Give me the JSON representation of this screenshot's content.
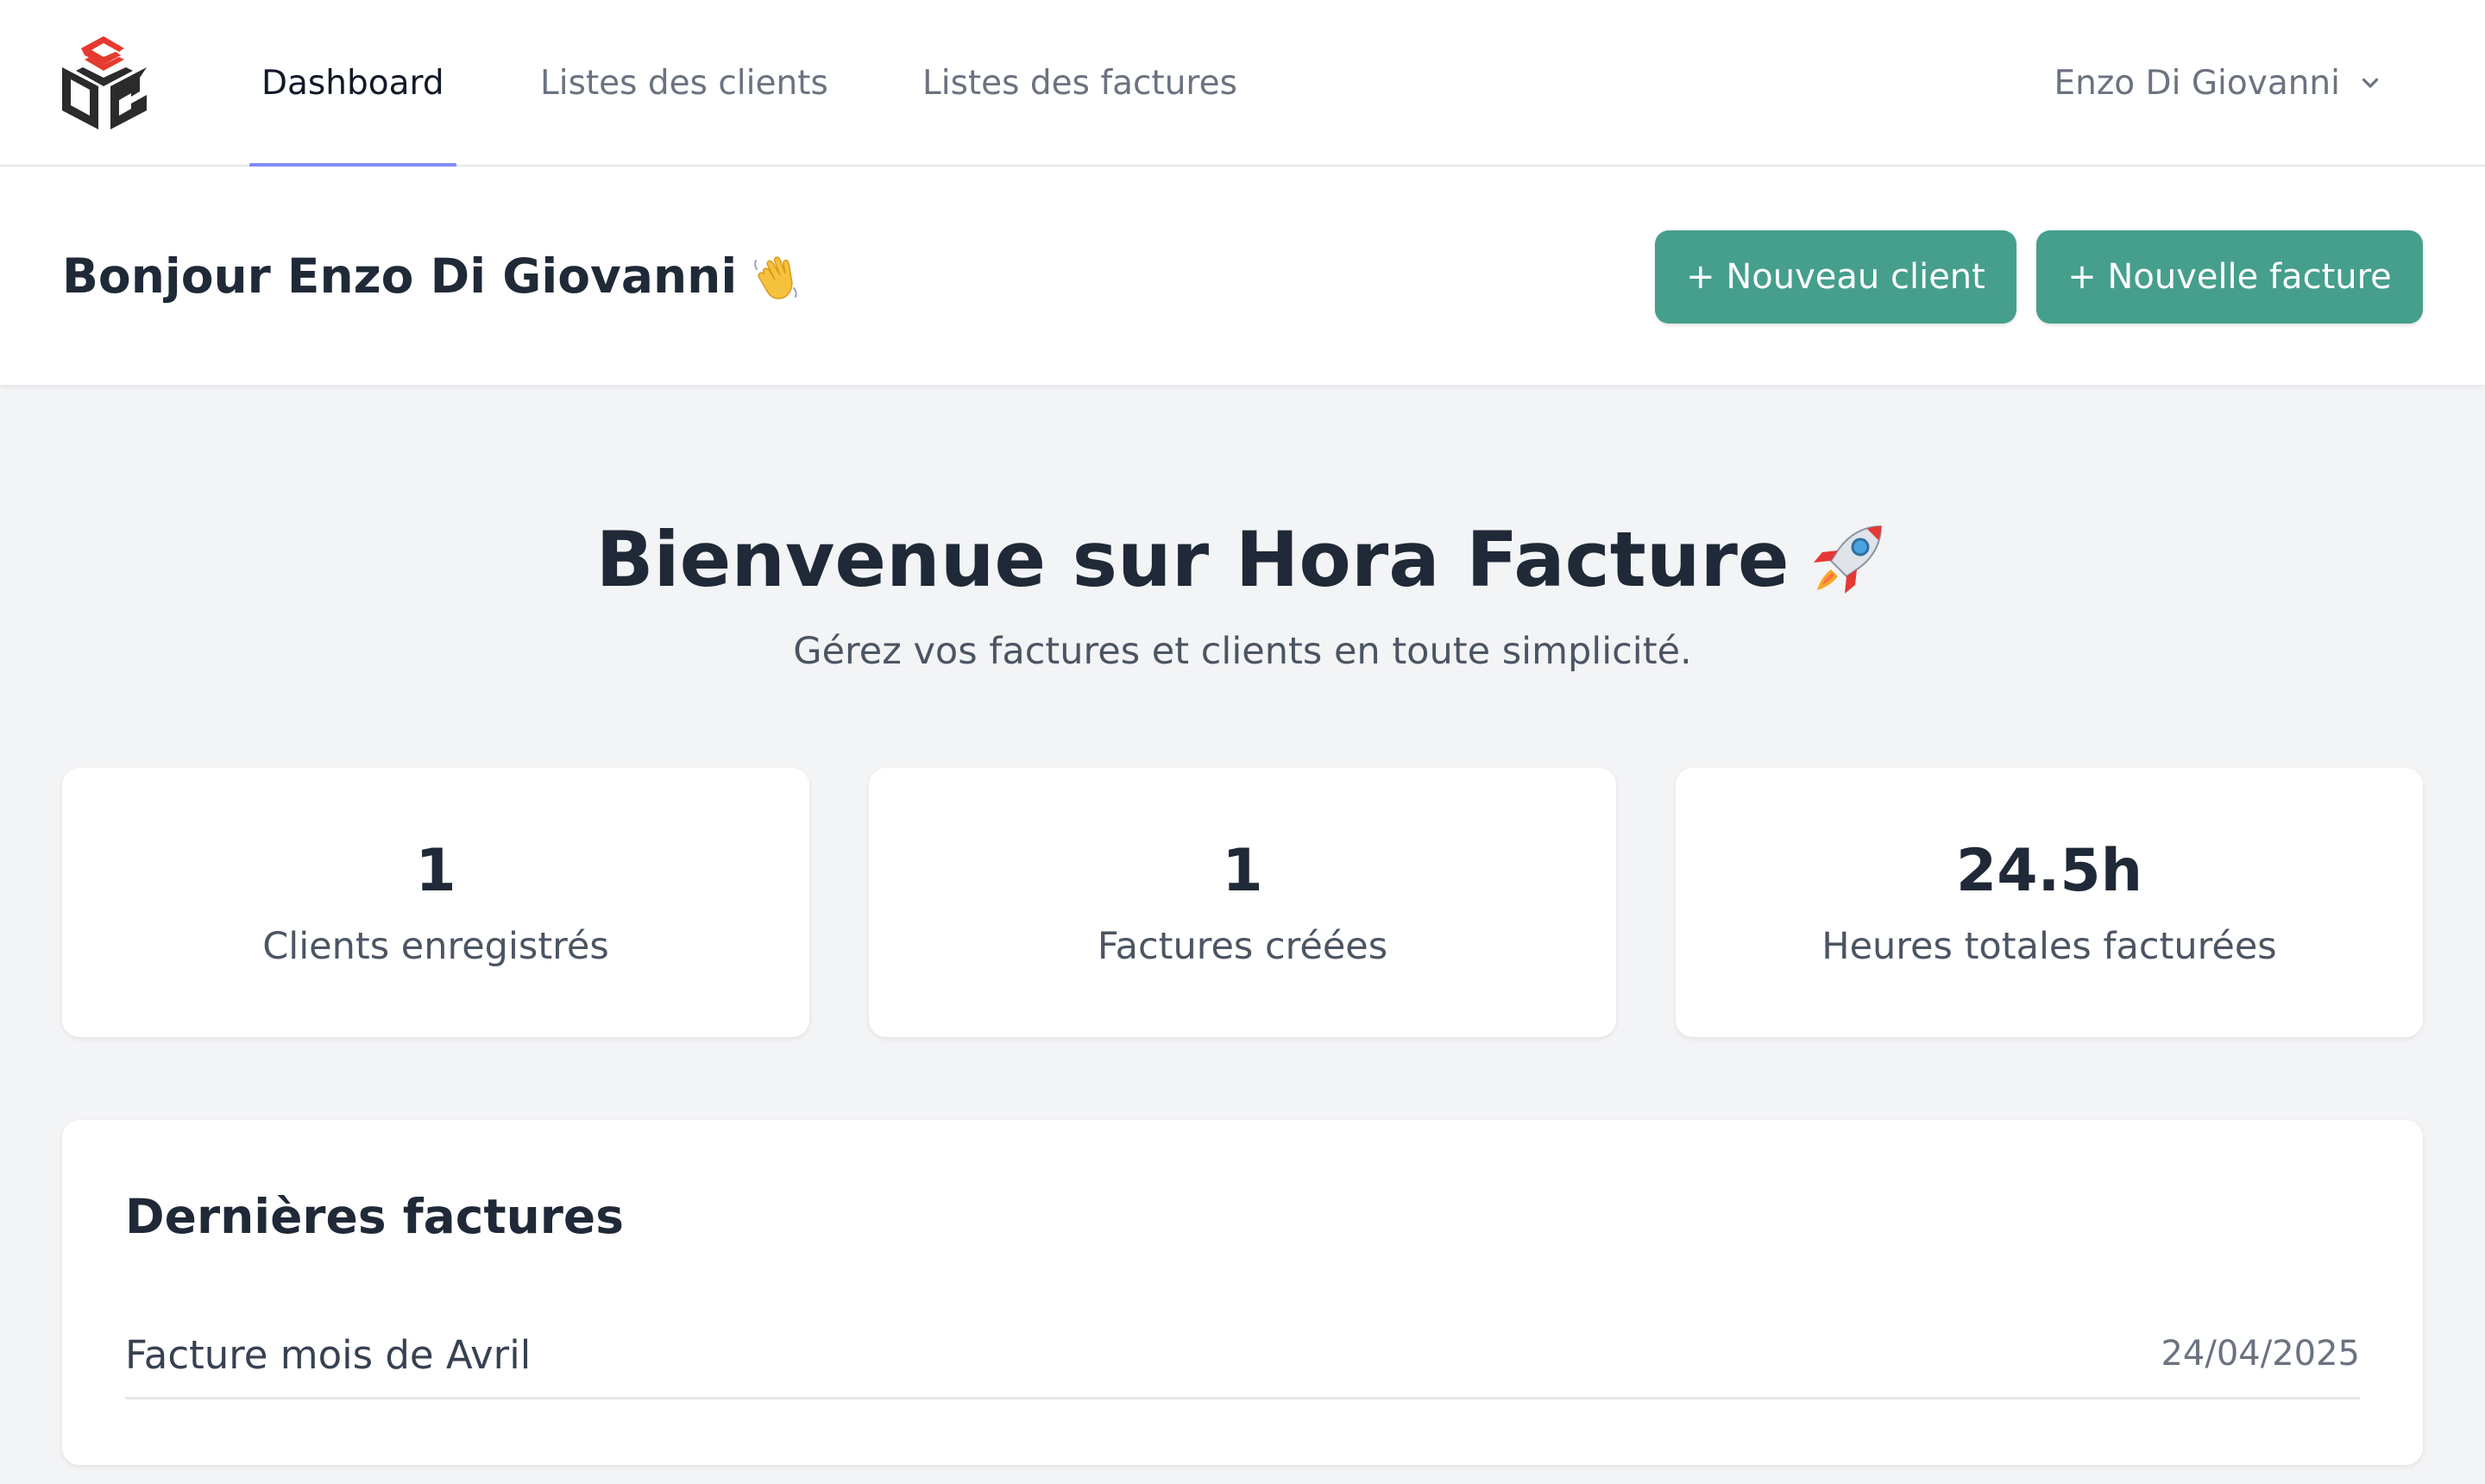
{
  "nav": {
    "tabs": [
      {
        "label": "Dashboard",
        "active": true
      },
      {
        "label": "Listes des clients",
        "active": false
      },
      {
        "label": "Listes des factures",
        "active": false
      }
    ],
    "user_name": "Enzo Di Giovanni",
    "active_tab_color": "#818cf8",
    "logo_colors": {
      "accent": "#e63a30",
      "dark": "#2b2b2b"
    }
  },
  "header": {
    "greeting": "Bonjour Enzo Di Giovanni",
    "greeting_icon": "waving-hand-icon",
    "buttons": {
      "new_client": "+ Nouveau client",
      "new_invoice": "+ Nouvelle facture"
    },
    "button_color": "#459f8c"
  },
  "hero": {
    "title": "Bienvenue sur Hora Facture",
    "title_icon": "rocket-icon",
    "subtitle": "Gérez vos factures et clients en toute simplicité."
  },
  "stats": [
    {
      "value": "1",
      "label": "Clients enregistrés"
    },
    {
      "value": "1",
      "label": "Factures créées"
    },
    {
      "value": "24.5h",
      "label": "Heures totales facturées"
    }
  ],
  "latest": {
    "title": "Dernières factures",
    "items": [
      {
        "name": "Facture mois de Avril",
        "date": "24/04/2025"
      }
    ]
  }
}
